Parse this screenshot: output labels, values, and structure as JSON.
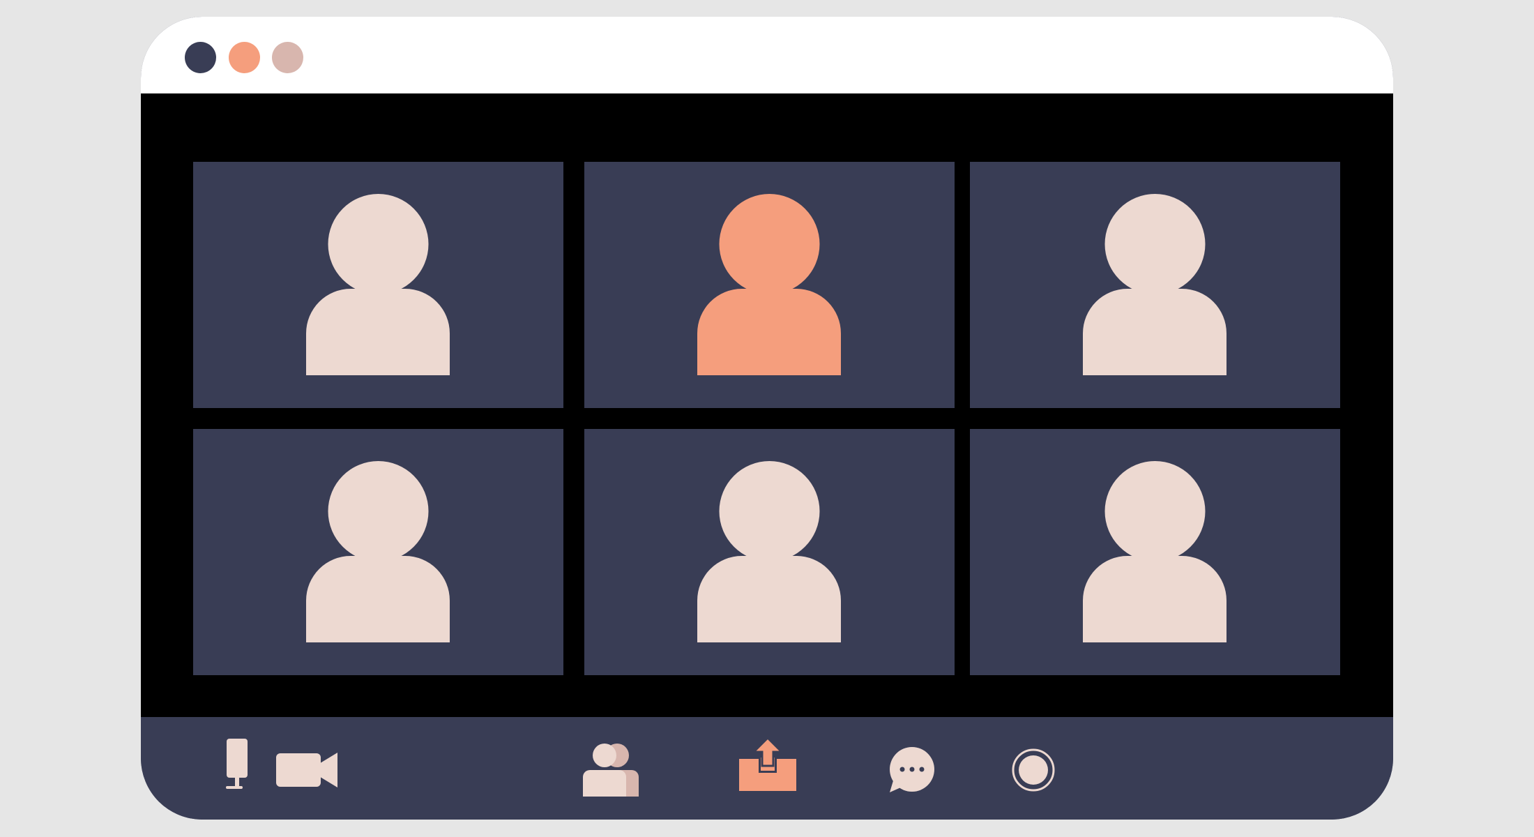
{
  "colors": {
    "page_background": "#e6e6e6",
    "window_body": "#393d55",
    "titlebar": "#ffffff",
    "video_background": "#000000",
    "tile_background": "#393d55",
    "avatar_default": "#edd9d1",
    "avatar_highlight": "#f59e7d",
    "traffic_close": "#393d55",
    "traffic_minimize": "#f59e7d",
    "traffic_maximize": "#d8b6ae",
    "toolbar_icon": "#edd9d1",
    "share_icon": "#f59e7d"
  },
  "window_controls": [
    {
      "name": "close",
      "color": "#393d55"
    },
    {
      "name": "minimize",
      "color": "#f59e7d"
    },
    {
      "name": "maximize",
      "color": "#d8b6ae"
    }
  ],
  "participants": [
    {
      "id": 1,
      "avatar": "person-silhouette",
      "active_speaker": false
    },
    {
      "id": 2,
      "avatar": "person-silhouette",
      "active_speaker": true
    },
    {
      "id": 3,
      "avatar": "person-silhouette",
      "active_speaker": false
    },
    {
      "id": 4,
      "avatar": "person-silhouette",
      "active_speaker": false
    },
    {
      "id": 5,
      "avatar": "person-silhouette",
      "active_speaker": false
    },
    {
      "id": 6,
      "avatar": "person-silhouette",
      "active_speaker": false
    }
  ],
  "toolbar": {
    "items": [
      {
        "name": "microphone",
        "icon": "microphone-icon"
      },
      {
        "name": "camera",
        "icon": "video-camera-icon"
      },
      {
        "name": "participants",
        "icon": "participants-icon"
      },
      {
        "name": "share-screen",
        "icon": "share-screen-icon"
      },
      {
        "name": "chat",
        "icon": "chat-icon"
      },
      {
        "name": "record",
        "icon": "record-icon"
      }
    ]
  }
}
